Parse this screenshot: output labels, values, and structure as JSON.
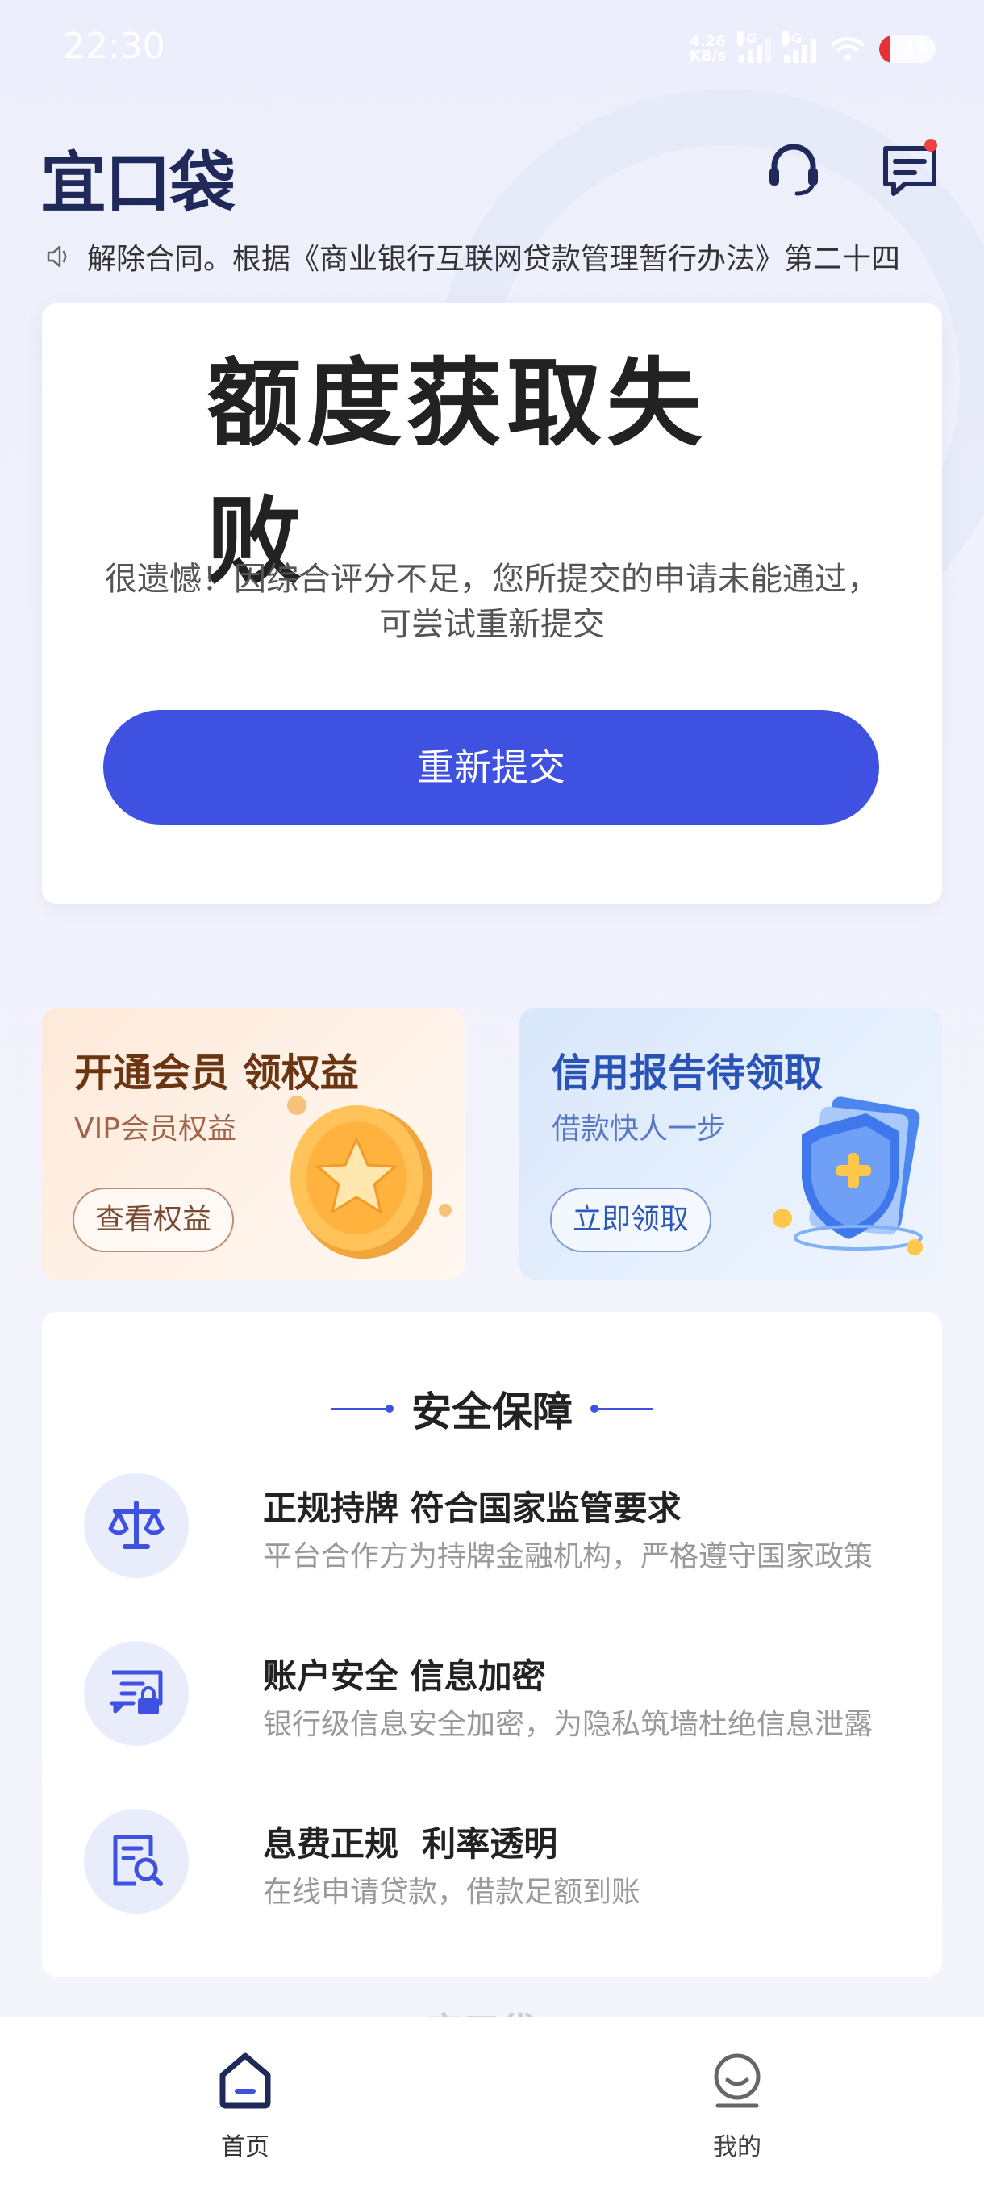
{
  "status_bar": {
    "time": "22:30",
    "net_speed_value": "4.26",
    "net_speed_unit": "KB/s",
    "sim1_label": "5G",
    "sim2_label": "5G",
    "battery": "17"
  },
  "header": {
    "logo": "宜口袋"
  },
  "notice": {
    "text": "解除合同。根据《商业银行互联网贷款管理暂行办法》第二十四"
  },
  "result": {
    "title": "额度获取失败",
    "description": "很遗憾！因综合评分不足，您所提交的申请未能通过，可尝试重新提交",
    "button": "重新提交"
  },
  "promos": [
    {
      "title": "开通会员 领权益",
      "subtitle": "VIP会员权益",
      "button": "查看权益"
    },
    {
      "title": "信用报告待领取",
      "subtitle": "借款快人一步",
      "button": "立即领取"
    }
  ],
  "security": {
    "title": "安全保障",
    "items": [
      {
        "title": "正规持牌 符合国家监管要求",
        "desc": "平台合作方为持牌金融机构，严格遵守国家政策",
        "icon": "scale-icon"
      },
      {
        "title": "账户安全 信息加密",
        "desc": "银行级信息安全加密，为隐私筑墙杜绝信息泄露",
        "icon": "secure-card-icon"
      },
      {
        "title": "息费正规  利率透明",
        "desc": "在线申请贷款，借款足额到账",
        "icon": "document-search-icon"
      }
    ]
  },
  "footer": {
    "logo": "宜口袋"
  },
  "tabbar": {
    "home": "首页",
    "mine": "我的"
  },
  "colors": {
    "accent": "#3f51e0",
    "brand_dark": "#1f2a5a"
  }
}
